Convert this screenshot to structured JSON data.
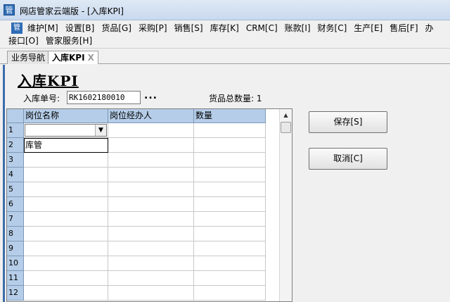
{
  "window": {
    "title": "网店管家云端版 - [入库KPI]",
    "icon_glyph": "管"
  },
  "menu": {
    "row1": [
      "维护[M]",
      "设置[B]",
      "货品[G]",
      "采购[P]",
      "销售[S]",
      "库存[K]",
      "CRM[C]",
      "账款[I]",
      "财务[C]",
      "生产[E]",
      "售后[F]",
      "办"
    ],
    "row2": [
      "接口[O]",
      "管家服务[H]"
    ]
  },
  "tabs": {
    "nav": "业务导航",
    "active": "入库KPI",
    "close": "X"
  },
  "form": {
    "title": "入库KPI",
    "order_label": "入库单号:",
    "order_value": "RK1602180010",
    "ellipsis": "...",
    "count_label": "货品总数量: 1"
  },
  "grid": {
    "columns": [
      "岗位名称",
      "岗位经办人",
      "数量"
    ],
    "rows": [
      {
        "n": "1",
        "c1": "",
        "c2": "",
        "c3": ""
      },
      {
        "n": "2",
        "c1": "库管",
        "c2": "",
        "c3": ""
      },
      {
        "n": "3",
        "c1": "",
        "c2": "",
        "c3": ""
      },
      {
        "n": "4",
        "c1": "",
        "c2": "",
        "c3": ""
      },
      {
        "n": "5",
        "c1": "",
        "c2": "",
        "c3": ""
      },
      {
        "n": "6",
        "c1": "",
        "c2": "",
        "c3": ""
      },
      {
        "n": "7",
        "c1": "",
        "c2": "",
        "c3": ""
      },
      {
        "n": "8",
        "c1": "",
        "c2": "",
        "c3": ""
      },
      {
        "n": "9",
        "c1": "",
        "c2": "",
        "c3": ""
      },
      {
        "n": "10",
        "c1": "",
        "c2": "",
        "c3": ""
      },
      {
        "n": "11",
        "c1": "",
        "c2": "",
        "c3": ""
      },
      {
        "n": "12",
        "c1": "",
        "c2": "",
        "c3": ""
      }
    ]
  },
  "buttons": {
    "save": "保存[S]",
    "cancel": "取消[C]"
  },
  "colors": {
    "header_bg": "#b5cde8",
    "accent": "#3b6dab"
  }
}
